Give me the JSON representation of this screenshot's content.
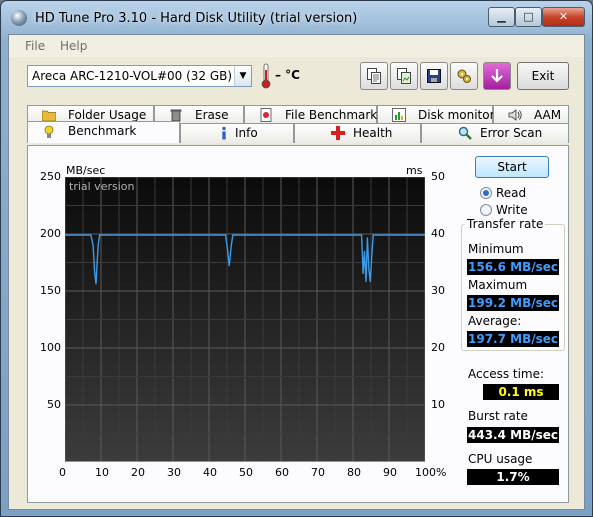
{
  "window": {
    "title": "HD Tune Pro 3.10 - Hard Disk Utility (trial version)",
    "min_label": "▁",
    "max_label": "□",
    "close_label": "✕"
  },
  "menu": {
    "file": "File",
    "help": "Help"
  },
  "toolbar": {
    "drive": "Areca   ARC-1210-VOL#00 (32 GB)",
    "temperature": "– °C",
    "exit_label": "Exit",
    "buttons": [
      {
        "icon": "copy-text-icon"
      },
      {
        "icon": "copy-screenshot-icon"
      },
      {
        "icon": "save-icon"
      },
      {
        "icon": "options-icon"
      },
      {
        "icon": "download-icon"
      }
    ]
  },
  "tabs": {
    "back": [
      {
        "label": "Folder Usage",
        "icon": "folder-icon"
      },
      {
        "label": "Erase",
        "icon": "trash-icon"
      },
      {
        "label": "File Benchmark",
        "icon": "file-benchmark-icon"
      },
      {
        "label": "Disk monitor",
        "icon": "disk-monitor-icon"
      },
      {
        "label": "AAM",
        "icon": "speaker-icon"
      }
    ],
    "front": [
      {
        "label": "Benchmark",
        "icon": "benchmark-icon"
      },
      {
        "label": "Info",
        "icon": "info-icon"
      },
      {
        "label": "Health",
        "icon": "health-icon"
      },
      {
        "label": "Error Scan",
        "icon": "magnifier-icon"
      }
    ]
  },
  "benchmark": {
    "start_label": "Start",
    "mode_options": [
      "Read",
      "Write"
    ],
    "selected_mode": "Read",
    "transfer_rate_title": "Transfer rate",
    "minimum_label": "Minimum",
    "minimum_value": "156.6 MB/sec",
    "maximum_label": "Maximum",
    "maximum_value": "199.2 MB/sec",
    "average_label": "Average:",
    "average_value": "197.7 MB/sec",
    "access_time_label": "Access time:",
    "access_time_value": "0.1 ms",
    "burst_rate_label": "Burst rate",
    "burst_rate_value": "443.4 MB/sec",
    "cpu_usage_label": "CPU usage",
    "cpu_usage_value": "1.7%",
    "value_colors": {
      "rate": "#3f9cff",
      "time": "#ffff00",
      "plain": "#ffffff"
    }
  },
  "chart_data": {
    "type": "line",
    "watermark": "trial version",
    "y_unit_left": "MB/sec",
    "y_unit_right": "ms",
    "y_ticks_left": [
      "250",
      "200",
      "150",
      "100",
      "50"
    ],
    "y_ticks_right": [
      "50",
      "40",
      "30",
      "20",
      "10"
    ],
    "x_ticks": [
      "0",
      "10",
      "20",
      "30",
      "40",
      "50",
      "60",
      "70",
      "80",
      "90",
      "100%"
    ],
    "ylim": [
      0,
      250
    ],
    "ylim_right": [
      0,
      50
    ],
    "xlim": [
      0,
      100
    ],
    "grid": true,
    "series": [
      {
        "color": "#3a9bea",
        "x": [
          0,
          7.2,
          7.8,
          8.2,
          8.6,
          9.2,
          9.6,
          44.6,
          45.2,
          45.6,
          46.2,
          46.6,
          82.4,
          82.8,
          83.2,
          83.6,
          84.0,
          84.4,
          84.8,
          85.2,
          85.6,
          100
        ],
        "y": [
          199,
          199,
          190,
          168,
          156,
          190,
          199,
          199,
          185,
          172,
          190,
          199,
          199,
          165,
          185,
          158,
          197,
          170,
          158,
          180,
          199,
          199
        ]
      },
      {
        "color": "#d8d23a",
        "x": [
          0,
          100
        ],
        "y": [
          0.1,
          0.1
        ]
      }
    ]
  }
}
